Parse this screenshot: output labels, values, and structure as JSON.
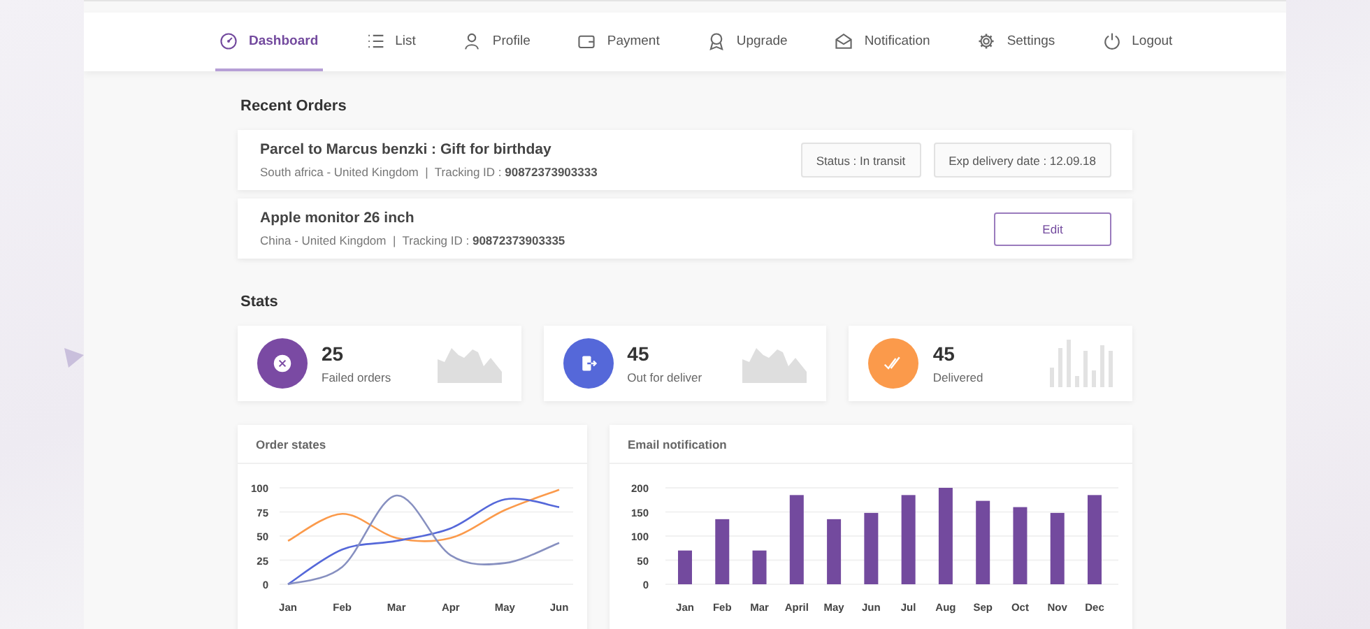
{
  "nav": [
    {
      "label": "Dashboard",
      "selected": true
    },
    {
      "label": "List",
      "selected": false
    },
    {
      "label": "Profile",
      "selected": false
    },
    {
      "label": "Payment",
      "selected": false
    },
    {
      "label": "Upgrade",
      "selected": false
    },
    {
      "label": "Notification",
      "selected": false
    },
    {
      "label": "Settings",
      "selected": false
    },
    {
      "label": "Logout",
      "selected": false
    }
  ],
  "recent_orders": {
    "title": "Recent Orders",
    "orders": [
      {
        "title": "Parcel to Marcus benzki : Gift for birthday",
        "details": "South africa - United Kingdom  |  Tracking ID : **90872373903333**",
        "actions": [
          {
            "kind": "badge",
            "label": "Status : In transit"
          },
          {
            "kind": "badge",
            "label": "Exp delivery date : 12.09.18"
          }
        ]
      },
      {
        "title": "Apple monitor 26 inch",
        "details": "China - United Kingdom  |  Tracking ID : **90872373903335**",
        "actions": [
          {
            "kind": "button",
            "label": "Edit"
          }
        ]
      }
    ]
  },
  "stats": {
    "title": "Stats",
    "cards": [
      {
        "value": "25",
        "label": "Failed orders",
        "color": "#7a4aa3",
        "kind": "area"
      },
      {
        "value": "45",
        "label": "Out for deliver",
        "color": "#5568d9",
        "kind": "area"
      },
      {
        "value": "45",
        "label": "Delivered",
        "color": "#fb9a4b",
        "kind": "bars"
      }
    ]
  },
  "order_states": {
    "title": "Order states",
    "chart_data": {
      "type": "line",
      "categories": [
        "Jan",
        "Feb",
        "Mar",
        "Apr",
        "May",
        "Jun"
      ],
      "ylim": [
        0,
        100
      ],
      "yticks": [
        0,
        25,
        50,
        75,
        100
      ],
      "grid": true,
      "series": [
        {
          "color": "#fb9a4b",
          "values": [
            45,
            73,
            48,
            48,
            77,
            98
          ]
        },
        {
          "color": "#5568d9",
          "values": [
            0,
            36,
            45,
            58,
            88,
            80
          ]
        },
        {
          "color": "#8790c0",
          "values": [
            0,
            18,
            92,
            30,
            22,
            43
          ]
        }
      ]
    }
  },
  "email_notification": {
    "title": "Email notification",
    "chart_data": {
      "type": "bar",
      "categories": [
        "Jan",
        "Feb",
        "Mar",
        "April",
        "May",
        "Jun",
        "Jul",
        "Aug",
        "Sep",
        "Oct",
        "Nov",
        "Dec"
      ],
      "ylim": [
        0,
        200
      ],
      "yticks": [
        0,
        50,
        100,
        150,
        200
      ],
      "grid": true,
      "series": [
        {
          "color": "#734a9e",
          "values": [
            70,
            135,
            70,
            185,
            135,
            148,
            185,
            200,
            173,
            160,
            148,
            185
          ]
        }
      ]
    }
  }
}
